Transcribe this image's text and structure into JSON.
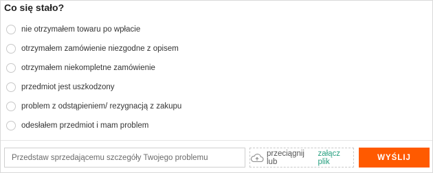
{
  "form": {
    "title": "Co się stało?",
    "options": [
      {
        "label": "nie otrzymałem towaru po wpłacie"
      },
      {
        "label": "otrzymałem zamówienie niezgodne z opisem"
      },
      {
        "label": "otrzymałem niekompletne zamówienie"
      },
      {
        "label": "przedmiot jest uszkodzony"
      },
      {
        "label": "problem z odstąpieniem/ rezygnacją z zakupu"
      },
      {
        "label": "odesłałem przedmiot i mam problem"
      }
    ],
    "description_placeholder": "Przedstaw sprzedającemu szczegóły Twojego problemu",
    "dropzone_text": "przeciągnij lub",
    "attach_link": "załącz plik",
    "dropzone_icon": "cloud-upload-icon",
    "send_label": "WYŚLIJ",
    "colors": {
      "accent": "#ff5a00",
      "link": "#27a080",
      "border": "#d9d9d9"
    }
  }
}
